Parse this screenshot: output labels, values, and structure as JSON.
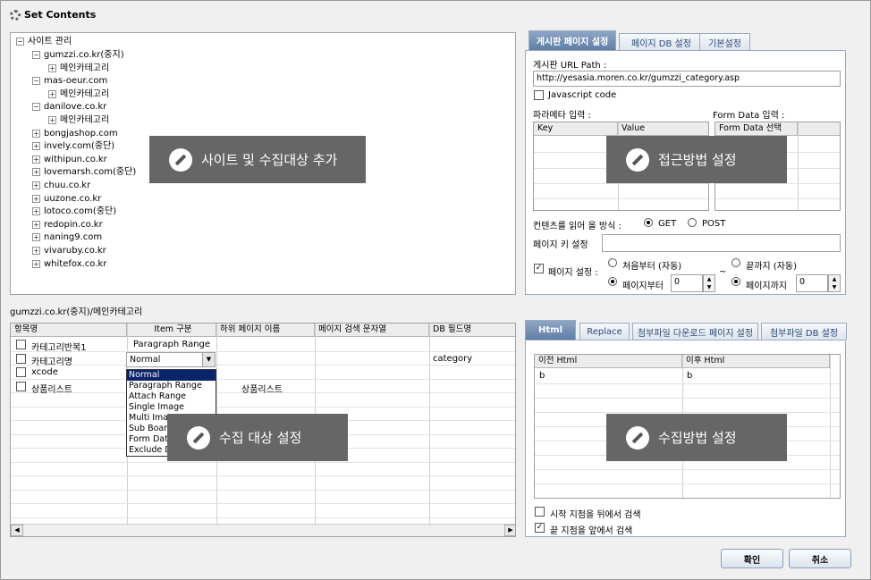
{
  "window": {
    "title": "Set Contents"
  },
  "tree": {
    "root": "사이트 관리",
    "items": [
      {
        "label": "gumzzi.co.kr(중지)",
        "child": "메인카테고리"
      },
      {
        "label": "mas-oeur.com",
        "child": "메인카테고리"
      },
      {
        "label": "danilove.co.kr",
        "child": "메인카테고리"
      },
      {
        "label": "bongjashop.com"
      },
      {
        "label": "invely.com(중단)"
      },
      {
        "label": "withipun.co.kr"
      },
      {
        "label": "lovemarsh.com(중단)"
      },
      {
        "label": "chuu.co.kr"
      },
      {
        "label": "uuzone.co.kr"
      },
      {
        "label": "lotoco.com(중단)"
      },
      {
        "label": "redopin.co.kr"
      },
      {
        "label": "naning9.com"
      },
      {
        "label": "vivaruby.co.kr"
      },
      {
        "label": "whitefox.co.kr"
      }
    ]
  },
  "overlays": {
    "site": "사이트 및 수집대상 추가",
    "access": "접근방법 설정",
    "target": "수집 대상 설정",
    "method": "수집방법 설정"
  },
  "top_tabs": [
    "게시판 페이지 설정",
    "페이지 DB 설정",
    "기본설정"
  ],
  "access": {
    "url_label": "게시판 URL Path :",
    "url_value": "http://yesasia.moren.co.kr/gumzzi_category.asp",
    "js_label": "Javascript code",
    "param_label": "파라메타 입력 :",
    "form_label": "Form Data 입력 :",
    "param_cols": [
      "Key",
      "Value"
    ],
    "form_cols": [
      "Form Data 선택"
    ],
    "read_label": "컨텐츠를 읽어 올 방식 :",
    "get": "GET",
    "post": "POST",
    "pagekey_label": "페이지 키 설정",
    "page_setting_label": "페이지 설정 :",
    "from_start": "처음부터 (자동)",
    "to_end": "끝까지 (자동)",
    "page_from": "페이지부터",
    "page_to": "페이지까지",
    "tilde": "~",
    "from_value": "0",
    "to_value": "0"
  },
  "breadcrumb": "gumzzi.co.kr(중지)/메인카테고리",
  "items_table": {
    "columns": [
      "항목명",
      "Item 구분",
      "하위 페이지 이름",
      "페이지 검색 문자열",
      "DB 필드명"
    ],
    "rows": [
      {
        "name": "카테고리반복1",
        "type": "Paragraph Range",
        "sub": "",
        "search": "",
        "db": ""
      },
      {
        "name": "카테고리명",
        "type": "Normal",
        "sub": "",
        "search": "",
        "db": "category"
      },
      {
        "name": "xcode",
        "type": "",
        "sub": "",
        "search": "",
        "db": ""
      },
      {
        "name": "상품리스트",
        "type": "",
        "sub": "상품리스트",
        "search": "",
        "db": ""
      }
    ],
    "dropdown_options": [
      "Normal",
      "Paragraph Range",
      "Attach Range",
      "Single Image",
      "Multi Image",
      "Sub Board Name",
      "Form Data",
      "Exclude Data"
    ]
  },
  "bottom_tabs": [
    "Html",
    "Replace",
    "첨부파일 다운로드 페이지 설정",
    "첨부파일 DB 설정"
  ],
  "replace": {
    "cols": [
      "이전 Html",
      "이후 Html"
    ],
    "rows": [
      [
        "b",
        "b"
      ]
    ],
    "opt1": "시작 지점을 뒤에서 검색",
    "opt2": "끝 지점을 앞에서 검색"
  },
  "buttons": {
    "ok": "확인",
    "cancel": "취소"
  }
}
